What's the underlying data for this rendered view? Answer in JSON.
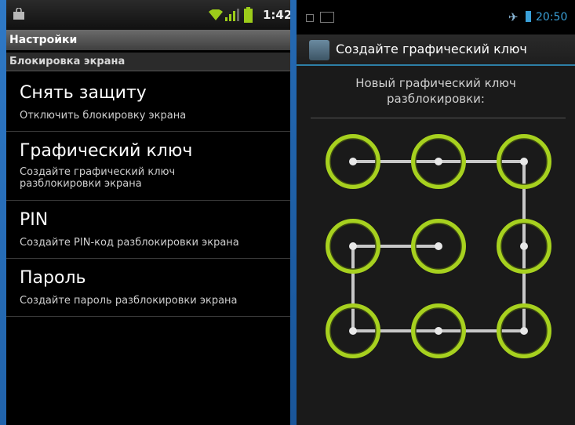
{
  "left_screen": {
    "status_bar": {
      "time": "1:42"
    },
    "title": "Настройки",
    "section": "Блокировка экрана",
    "items": [
      {
        "title": "Снять защиту",
        "summary": "Отключить блокировку экрана"
      },
      {
        "title": "Графический ключ",
        "summary": "Создайте графический ключ разблокировки экрана"
      },
      {
        "title": "PIN",
        "summary": "Создайте PIN-код разблокировки экрана"
      },
      {
        "title": "Пароль",
        "summary": "Создайте пароль разблокировки экрана"
      }
    ]
  },
  "right_screen": {
    "status_bar": {
      "time": "20:50"
    },
    "title": "Создайте графический ключ",
    "instruction_line1": "Новый графический ключ",
    "instruction_line2": "разблокировки:",
    "pattern_color": "#a7d11f",
    "pattern_sequence": [
      1,
      2,
      3,
      6,
      9,
      8,
      7,
      4,
      5
    ]
  }
}
